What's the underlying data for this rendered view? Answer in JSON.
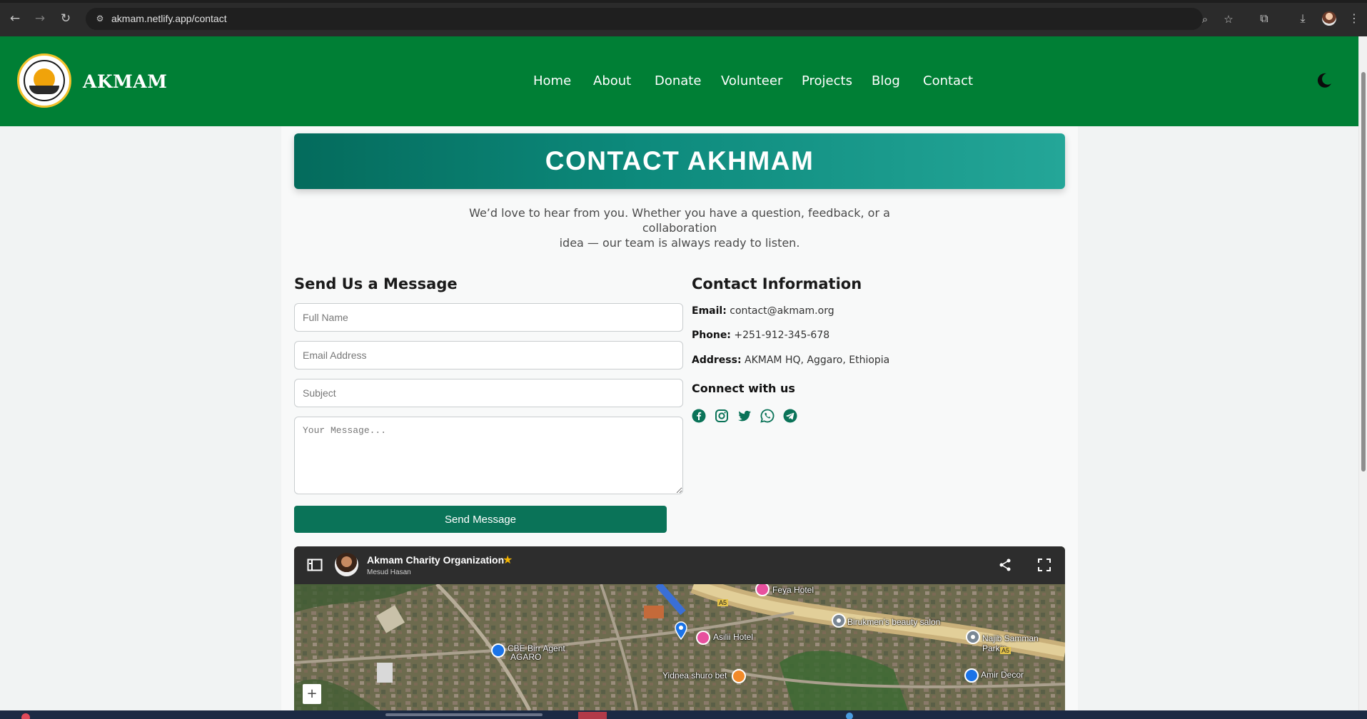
{
  "browser": {
    "url": "akmam.netlify.app/contact"
  },
  "site": {
    "brand": "AKMAM",
    "nav": [
      "Home",
      "About",
      "Donate",
      "Volunteer",
      "Projects",
      "Blog",
      "Contact"
    ],
    "theme_toggle_icon": "moon-icon"
  },
  "banner": {
    "title": "CONTACT AKHMAM"
  },
  "intro": {
    "line1": "We’d love to hear from you. Whether you have a question, feedback, or a collaboration",
    "line2": "idea — our team is always ready to listen."
  },
  "form": {
    "title": "Send Us a Message",
    "name_placeholder": "Full Name",
    "email_placeholder": "Email Address",
    "subject_placeholder": "Subject",
    "message_placeholder": "Your Message...",
    "submit_label": "Send Message"
  },
  "contact": {
    "title": "Contact Information",
    "email_label": "Email:",
    "email_value": "contact@akmam.org",
    "phone_label": "Phone:",
    "phone_value": "+251-912-345-678",
    "address_label": "Address:",
    "address_value": "AKMAM HQ, Aggaro, Ethiopia",
    "connect_title": "Connect with us",
    "social_icons": [
      "facebook-icon",
      "instagram-icon",
      "twitter-icon",
      "whatsapp-icon",
      "telegram-icon"
    ],
    "social_color": "#0a7358"
  },
  "map": {
    "title": "Akmam Charity Organization",
    "subtitle": "Mesud Hasan",
    "labels": {
      "feya": "Feya Hotel",
      "birukmen": "Birukmen's beauty salon",
      "najib": "Najib Samman Parkin",
      "asili": "Asilii Hotel",
      "cbe": "CBE Birr Agent",
      "agaro": "AGARO",
      "yidnea": "Yidnea shuro bet",
      "amir": "Amir Decor",
      "a5a": "A5",
      "a5b": "A5"
    },
    "zoom_in_label": "+"
  },
  "colors": {
    "header_green": "#007f35",
    "banner_teal": "#0d8a7c",
    "button_green": "#0a7358"
  }
}
